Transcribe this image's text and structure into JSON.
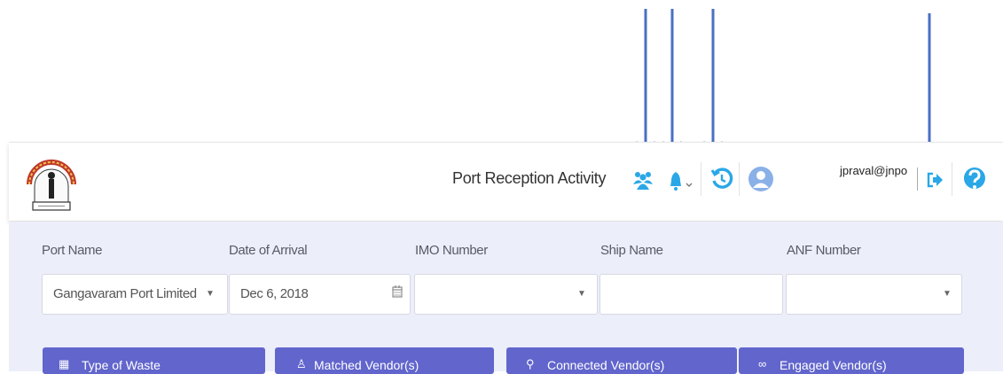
{
  "header": {
    "title": "Port Reception Activity",
    "user": "jpraval@jnpo",
    "icons": [
      "users-icon",
      "bell-icon",
      "history-icon",
      "avatar-icon",
      "logout-icon",
      "help-icon"
    ]
  },
  "form": {
    "port_name": {
      "label": "Port Name",
      "value": "Gangavaram Port Limited"
    },
    "date_of_arrival": {
      "label": "Date of Arrival",
      "value": "Dec 6, 2018"
    },
    "imo_number": {
      "label": "IMO Number",
      "value": ""
    },
    "ship_name": {
      "label": "Ship Name",
      "value": ""
    },
    "anf_number": {
      "label": "ANF Number",
      "value": ""
    }
  },
  "tabs": [
    {
      "label": "Type of Waste"
    },
    {
      "label": "Matched Vendor(s)"
    },
    {
      "label": "Connected Vendor(s)"
    },
    {
      "label": "Engaged Vendor(s)"
    }
  ],
  "colors": {
    "arrow": "#4a6fc4",
    "accent": "#6165cc",
    "icon_blue": "#2aa7e6",
    "panel_bg": "#eceef9"
  }
}
